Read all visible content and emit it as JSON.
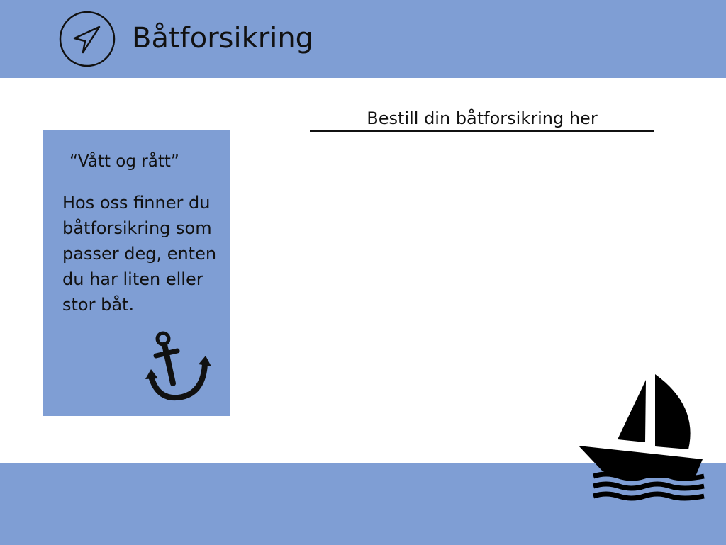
{
  "header": {
    "logo_icon": "navigation-arrow-icon",
    "title": "Båtforsikring"
  },
  "main": {
    "order_link": "Bestill din båtforsikring her"
  },
  "info_card": {
    "quote": "“Vått og rått”",
    "text": "Hos oss finner du båtforsikring som passer deg, enten du har liten eller stor båt.",
    "icon": "anchor-icon"
  },
  "footer": {
    "icon": "sailboat-icon"
  },
  "colors": {
    "accent": "#7f9ed4",
    "text": "#111111",
    "background": "#ffffff"
  }
}
